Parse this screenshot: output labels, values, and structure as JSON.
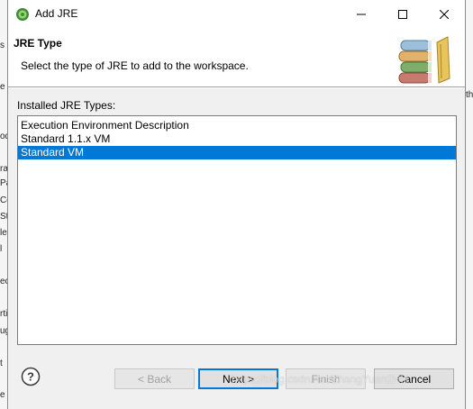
{
  "window": {
    "title": "Add JRE",
    "minimize_symbol": "—",
    "maximize_symbol": "☐",
    "close_symbol": "✕"
  },
  "banner": {
    "title": "JRE Type",
    "message": "Select the type of JRE to add to the workspace."
  },
  "list": {
    "label": "Installed JRE Types:",
    "items": [
      "Execution Environment Description",
      "Standard 1.1.x VM",
      "Standard VM"
    ],
    "selected_index": 2
  },
  "buttons": {
    "back": "< Back",
    "next": "Next >",
    "finish": "Finish",
    "cancel": "Cancel",
    "help": "?"
  },
  "watermark": "https://blog.csdn.net/ZhangYuan2HH",
  "background": {
    "left_fragments": [
      "s",
      "e",
      "od",
      "ra",
      "Pa",
      "Co",
      "St",
      "le",
      "l",
      "ec",
      "rti",
      "ug",
      "t",
      "e S"
    ],
    "right_fragments": [
      "th"
    ]
  },
  "colors": {
    "selection": "#0078d7",
    "default_button_border": "#0078d7",
    "dialog_bg": "#f0f0f0",
    "banner_bg": "#ffffff"
  }
}
